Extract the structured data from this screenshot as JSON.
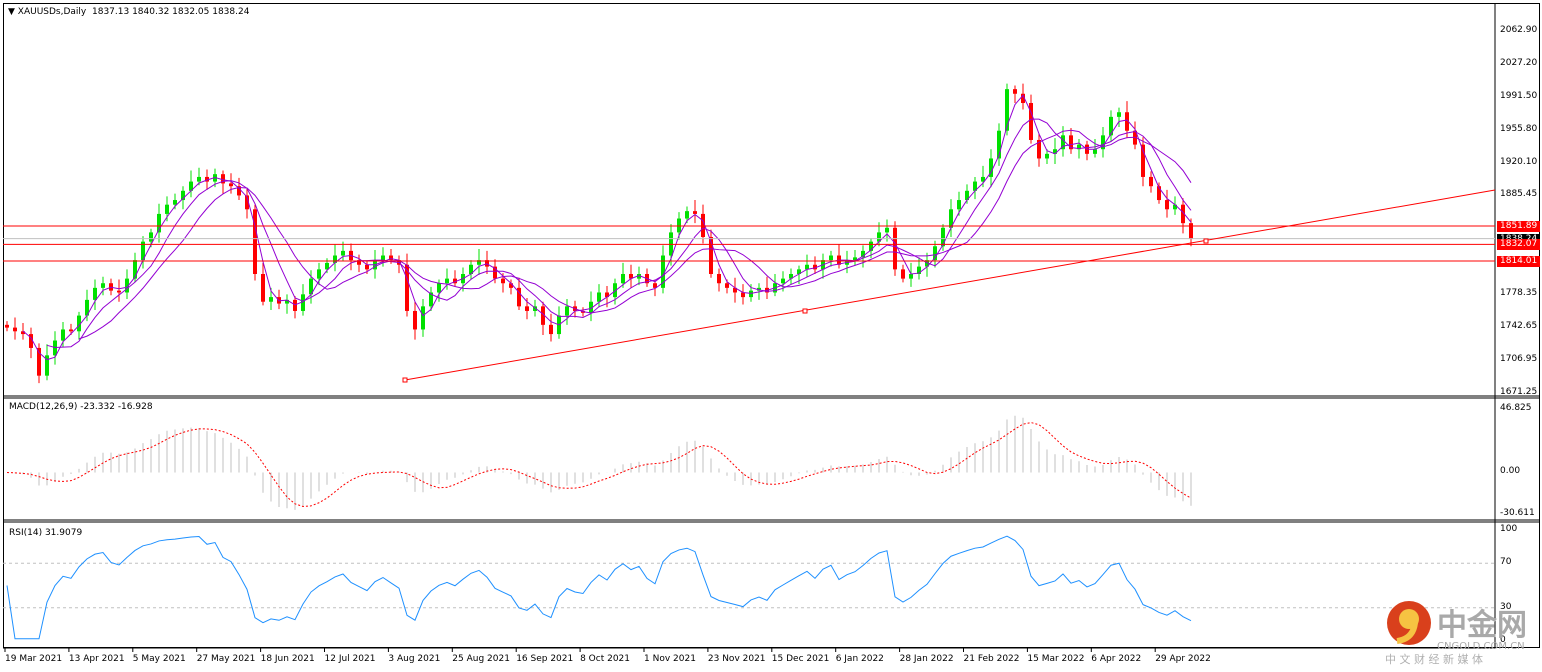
{
  "header": {
    "symbol": "XAUUSDs,Daily",
    "ohlc": "1837.13 1840.32 1832.05 1838.24"
  },
  "chart_data": {
    "type": "candlestick",
    "symbol": "XAUUSDs",
    "timeframe": "Daily",
    "ylim": [
      1671.25,
      2062.9
    ],
    "price_ticks": [
      "2062.90",
      "2027.20",
      "1991.50",
      "1955.80",
      "1920.10",
      "1885.45",
      "1778.35",
      "1742.65",
      "1706.95",
      "1671.25"
    ],
    "date_ticks": [
      "19 Mar 2021",
      "13 Apr 2021",
      "5 May 2021",
      "27 May 2021",
      "18 Jun 2021",
      "12 Jul 2021",
      "3 Aug 2021",
      "25 Aug 2021",
      "16 Sep 2021",
      "8 Oct 2021",
      "1 Nov 2021",
      "23 Nov 2021",
      "15 Dec 2021",
      "6 Jan 2022",
      "28 Jan 2022",
      "21 Feb 2022",
      "15 Mar 2022",
      "6 Apr 2022",
      "29 Apr 2022"
    ],
    "close": [
      1742,
      1738,
      1735,
      1720,
      1690,
      1712,
      1728,
      1740,
      1738,
      1755,
      1772,
      1785,
      1790,
      1782,
      1780,
      1795,
      1815,
      1835,
      1845,
      1865,
      1875,
      1880,
      1890,
      1900,
      1905,
      1900,
      1908,
      1898,
      1895,
      1885,
      1870,
      1800,
      1770,
      1775,
      1768,
      1772,
      1760,
      1778,
      1795,
      1805,
      1812,
      1820,
      1825,
      1815,
      1810,
      1805,
      1815,
      1820,
      1815,
      1810,
      1760,
      1740,
      1765,
      1780,
      1790,
      1795,
      1790,
      1800,
      1810,
      1815,
      1808,
      1795,
      1790,
      1785,
      1765,
      1760,
      1765,
      1745,
      1735,
      1755,
      1765,
      1760,
      1758,
      1770,
      1780,
      1775,
      1790,
      1800,
      1795,
      1800,
      1790,
      1785,
      1820,
      1845,
      1860,
      1868,
      1865,
      1840,
      1800,
      1790,
      1785,
      1780,
      1775,
      1782,
      1785,
      1780,
      1790,
      1795,
      1800,
      1805,
      1810,
      1805,
      1815,
      1820,
      1810,
      1815,
      1818,
      1825,
      1835,
      1845,
      1850,
      1805,
      1795,
      1800,
      1808,
      1815,
      1830,
      1850,
      1870,
      1880,
      1890,
      1900,
      1905,
      1925,
      1955,
      2000,
      1995,
      1985,
      1945,
      1925,
      1930,
      1935,
      1950,
      1935,
      1940,
      1930,
      1935,
      1950,
      1970,
      1975,
      1955,
      1940,
      1905,
      1895,
      1880,
      1870,
      1875,
      1855,
      1838
    ],
    "horizontal_levels": [
      {
        "price": "1851.89",
        "color": "#ff0000"
      },
      {
        "price": "1838.24",
        "color": "#c0c0c0"
      },
      {
        "price": "1832.07",
        "color": "#ff0000"
      },
      {
        "price": "1814.01",
        "color": "#ff0000"
      }
    ],
    "trendline": {
      "from_price": 1680,
      "to_price": 1887,
      "color": "#ff0000"
    },
    "colors": {
      "up": "#00e000",
      "down": "#ff0000",
      "ma": "#9400d3",
      "macd_hist": "#c0c0c0",
      "macd_signal": "#ff0000",
      "rsi": "#1e90ff"
    },
    "macd": {
      "label": "MACD(12,26,9) -23.332 -16.928",
      "ticks": [
        "46.825",
        "0.00",
        "-30.611"
      ],
      "ylim": [
        -30.611,
        46.825
      ]
    },
    "rsi": {
      "label": "RSI(14) 31.9079",
      "ticks": [
        "100",
        "70",
        "30",
        "0"
      ],
      "levels": [
        70,
        30
      ]
    }
  },
  "watermark": {
    "brand": "中金网",
    "domain": "CNGOLD.COM.CN",
    "tagline": "中 文 财 经 新 媒 体"
  }
}
